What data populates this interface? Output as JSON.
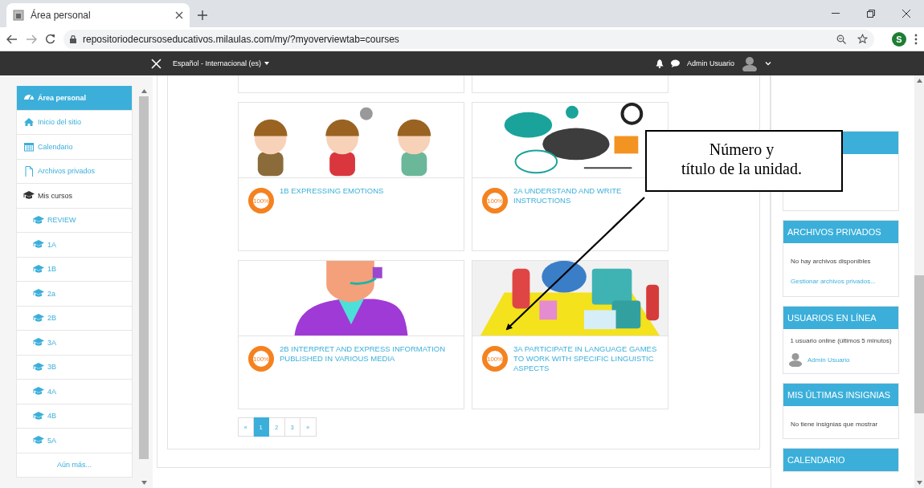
{
  "browser": {
    "tab": {
      "title": "Área personal"
    },
    "address": "repositoriodecursoseducativos.milaulas.com/my/?myoverviewtab=courses",
    "profile_initial": "S"
  },
  "navbar": {
    "language": "Español - Internacional (es)",
    "user": "Admin Usuario"
  },
  "sidebar": {
    "items": [
      {
        "label": "Área personal",
        "kind": "dashboard",
        "selected": true
      },
      {
        "label": "Inicio del sitio",
        "kind": "home",
        "selected": false
      },
      {
        "label": "Calendario",
        "kind": "calendar",
        "selected": false
      },
      {
        "label": "Archivos privados",
        "kind": "file",
        "selected": false
      },
      {
        "label": "Mis cursos",
        "kind": "courses",
        "selected": false
      },
      {
        "label": "REVIEW",
        "kind": "course",
        "selected": false
      },
      {
        "label": "1A",
        "kind": "course",
        "selected": false
      },
      {
        "label": "1B",
        "kind": "course",
        "selected": false
      },
      {
        "label": "2a",
        "kind": "course",
        "selected": false
      },
      {
        "label": "2B",
        "kind": "course",
        "selected": false
      },
      {
        "label": "3A",
        "kind": "course",
        "selected": false
      },
      {
        "label": "3B",
        "kind": "course",
        "selected": false
      },
      {
        "label": "4A",
        "kind": "course",
        "selected": false
      },
      {
        "label": "4B",
        "kind": "course",
        "selected": false
      },
      {
        "label": "5A",
        "kind": "course",
        "selected": false
      },
      {
        "label": "Aún más...",
        "kind": "more",
        "selected": false
      }
    ]
  },
  "courses": [
    {
      "title": "1B EXPRESSING EMOTIONS",
      "progress": "100%",
      "level": 1
    },
    {
      "title": "2A UNDERSTAND AND WRITE INSTRUCTIONS",
      "progress": "100%",
      "level": 1
    },
    {
      "title": "2B INTERPRET AND EXPRESS INFORMATION PUBLISHED IN VARIOUS MEDIA",
      "progress": "100%",
      "level": 1
    },
    {
      "title": "3A PARTICIPATE IN LANGUAGE GAMES TO WORK WITH SPECIFIC LINGUISTIC ASPECTS",
      "progress": "100%",
      "level": 1
    }
  ],
  "pagination": [
    {
      "label": "«",
      "selected": false
    },
    {
      "label": "1",
      "selected": true
    },
    {
      "label": "2",
      "selected": false
    },
    {
      "label": "3",
      "selected": false
    },
    {
      "label": "»",
      "selected": false
    }
  ],
  "blocks": [
    {
      "kind": "untitled"
    },
    {
      "title": "ARCHIVOS PRIVADOS",
      "lines": [
        {
          "kind": "text",
          "text": "No hay archivos disponibles"
        },
        {
          "kind": "link",
          "text": "Gestionar archivos privados..."
        }
      ]
    },
    {
      "title": "USUARIOS EN LÍNEA",
      "lines": [
        {
          "kind": "center",
          "text": "1 usuario online (últimos 5 minutos)"
        },
        {
          "kind": "user",
          "text": "Admin Usuario"
        }
      ]
    },
    {
      "title": "MIS ÚLTIMAS INSIGNIAS",
      "lines": [
        {
          "kind": "text",
          "text": "No tiene insignias que mostrar"
        }
      ]
    },
    {
      "title": "CALENDARIO"
    }
  ],
  "callout": {
    "text": "Número y\ntítulo de la unidad."
  }
}
